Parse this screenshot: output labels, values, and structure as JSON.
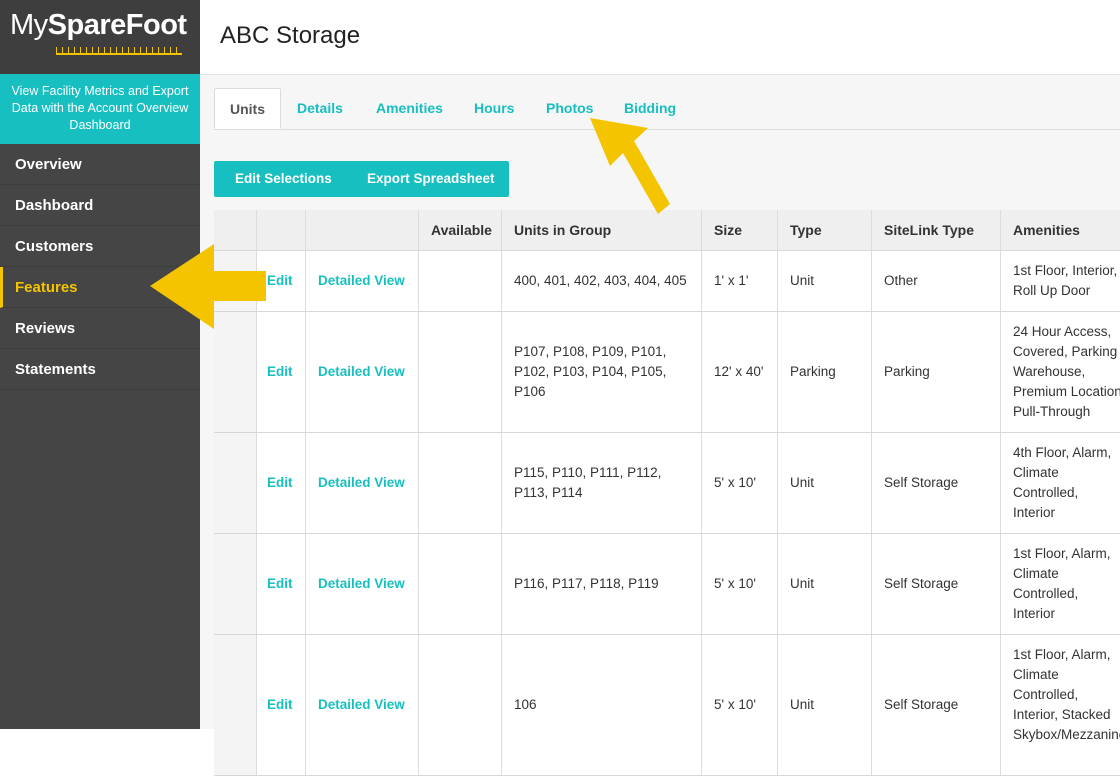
{
  "logo": {
    "part1": "My",
    "part2": "SpareFoot"
  },
  "promo": {
    "text": "View Facility Metrics and Export Data with the Account Overview Dashboard"
  },
  "nav": [
    {
      "label": "Overview",
      "active": false
    },
    {
      "label": "Dashboard",
      "active": false
    },
    {
      "label": "Customers",
      "active": false
    },
    {
      "label": "Features",
      "active": true
    },
    {
      "label": "Reviews",
      "active": false
    },
    {
      "label": "Statements",
      "active": false
    }
  ],
  "header": {
    "title": "ABC Storage"
  },
  "tabs": [
    "Units",
    "Details",
    "Amenities",
    "Hours",
    "Photos",
    "Bidding"
  ],
  "actions": {
    "edit_selections": "Edit Selections",
    "export_spreadsheet": "Export Spreadsheet"
  },
  "table": {
    "columns": [
      "",
      "",
      "",
      "Available",
      "Units in Group",
      "Size",
      "Type",
      "SiteLink Type",
      "Amenities"
    ],
    "rows": [
      {
        "edit": "Edit",
        "view": "Detailed View",
        "available": "",
        "units": [
          "400, 401, 402, 403, 404, 405"
        ],
        "size": "1' x 1'",
        "type": "Unit",
        "sitelink": "Other",
        "amenities": [
          "1st Floor, Interior,",
          "Roll Up Door"
        ]
      },
      {
        "edit": "Edit",
        "view": "Detailed View",
        "available": "",
        "units": [
          "P107, P108, P109, P101,",
          "P102, P103, P104, P105,",
          "P106"
        ],
        "size": "12' x 40'",
        "type": "Parking",
        "sitelink": "Parking",
        "amenities": [
          "24 Hour Access,",
          "Covered, Parking",
          "Warehouse,",
          "Premium Location,",
          "Pull-Through"
        ]
      },
      {
        "edit": "Edit",
        "view": "Detailed View",
        "available": "",
        "units": [
          "P115, P110, P111, P112,",
          "P113, P114"
        ],
        "size": "5' x 10'",
        "type": "Unit",
        "sitelink": "Self Storage",
        "amenities": [
          "4th Floor, Alarm,",
          "Climate",
          "Controlled,",
          "Interior"
        ]
      },
      {
        "edit": "Edit",
        "view": "Detailed View",
        "available": "",
        "units": [
          "P116, P117, P118, P119"
        ],
        "size": "5' x 10'",
        "type": "Unit",
        "sitelink": "Self Storage",
        "amenities": [
          "1st Floor, Alarm,",
          "Climate",
          "Controlled,",
          "Interior"
        ]
      },
      {
        "edit": "Edit",
        "view": "Detailed View",
        "available": "",
        "units": [
          "106"
        ],
        "size": "5' x 10'",
        "type": "Unit",
        "sitelink": "Self Storage",
        "amenities": [
          "1st Floor, Alarm,",
          "Climate",
          "Controlled,",
          "Interior, Stacked",
          "Skybox/Mezzanine"
        ]
      }
    ]
  },
  "colors": {
    "accent": "#17bfc1",
    "highlight": "#f4c400",
    "sidebar": "#454545"
  }
}
